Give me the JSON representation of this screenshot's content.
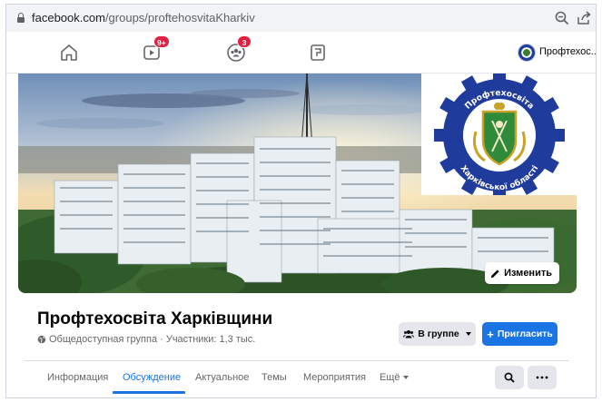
{
  "browser": {
    "url_host": "facebook.com",
    "url_path": "/groups/proftehosvitaKharkiv"
  },
  "fbnav": {
    "watch_badge": "9+",
    "groups_badge": "3",
    "profile_name": "Профтехос..."
  },
  "cover": {
    "edit_label": "Изменить",
    "emblem_text_top": "Профтехосвіта",
    "emblem_text_bottom": "Харківської області"
  },
  "group": {
    "title": "Профтехосвіта Харківщини",
    "meta": "Общедоступная группа · Участники: 1,3 тыс.",
    "joined_label": "В группе",
    "invite_label": "Пригласить"
  },
  "tabs": [
    {
      "label": "Информация"
    },
    {
      "label": "Обсуждение"
    },
    {
      "label": "Актуальное"
    },
    {
      "label": "Темы"
    },
    {
      "label": "Мероприятия"
    },
    {
      "label": "Ещё"
    }
  ],
  "colors": {
    "accent": "#1b74e4",
    "badge": "#e41e3f"
  }
}
